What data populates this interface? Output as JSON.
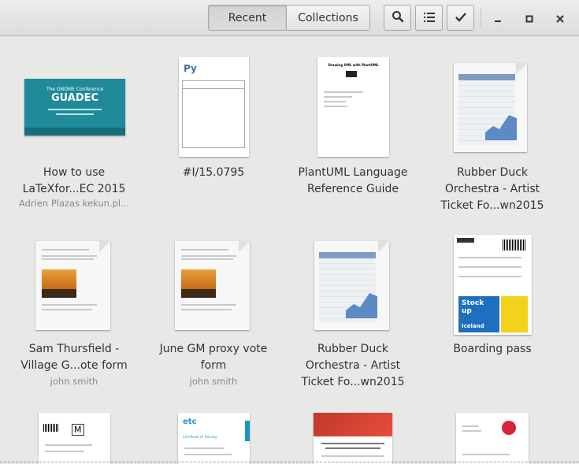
{
  "header": {
    "tabs": [
      {
        "label": "Recent",
        "active": true
      },
      {
        "label": "Collections",
        "active": false
      }
    ],
    "buttons": [
      "search-icon",
      "list-view-icon",
      "select-checkmark-icon"
    ],
    "window_controls": [
      "minimize-icon",
      "maximize-icon",
      "close-icon"
    ]
  },
  "documents": [
    {
      "title": "How to use LaTeXfor...EC 2015",
      "subtitle": "Adrien Plazas kekun.pl...",
      "thumb_text": [
        "GUADEC",
        "The GNOME Conference"
      ]
    },
    {
      "title": "#I/15.0795",
      "subtitle": "",
      "thumb_text": [
        "Py"
      ]
    },
    {
      "title": "PlantUML Language Reference Guide",
      "subtitle": "",
      "thumb_text": [
        "Drawing UML with PlantUML"
      ]
    },
    {
      "title": "Rubber Duck Orchestra - Artist Ticket Fo...wn2015",
      "subtitle": ""
    },
    {
      "title": "Sam Thursfield - Village G...ote form",
      "subtitle": "john smith"
    },
    {
      "title": "June GM proxy vote form",
      "subtitle": "john smith"
    },
    {
      "title": "Rubber Duck Orchestra - Artist Ticket Fo...wn2015",
      "subtitle": ""
    },
    {
      "title": "Boarding pass",
      "subtitle": "",
      "thumb_text": [
        "Stock up",
        "Iceland"
      ]
    },
    {
      "title": "",
      "subtitle": "",
      "thumb_text": [
        "M"
      ]
    },
    {
      "title": "",
      "subtitle": "",
      "thumb_text": [
        "etc",
        "Certificate of Training"
      ]
    },
    {
      "title": "",
      "subtitle": ""
    },
    {
      "title": "",
      "subtitle": ""
    }
  ],
  "colors": {
    "background": "#e8e8e7",
    "guadec_teal": "#1e8a9a",
    "chart_blue": "#5b8ac4",
    "sunset_orange": "#d98a2b",
    "boarding_blue": "#1e6fc0",
    "boarding_yellow": "#f2d21b",
    "red_banner": "#c0392b"
  }
}
